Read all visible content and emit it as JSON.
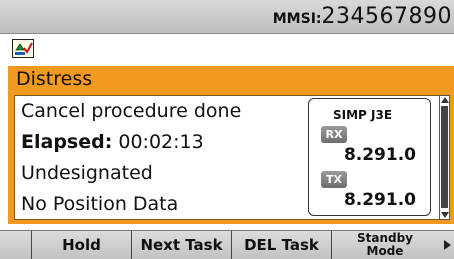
{
  "header": {
    "mmsi_label": "MMSI:",
    "mmsi_value": "234567890"
  },
  "status": {
    "icon": "position-update-icon"
  },
  "panel": {
    "title": "Distress",
    "lines": {
      "line1": "Cancel procedure done",
      "elapsed_label": "Elapsed:",
      "elapsed_value": "00:02:13",
      "line3": "Undesignated",
      "line4": "No Position Data"
    },
    "radio": {
      "channel": "SIMP J3E",
      "rx_label": "RX",
      "rx_freq": "8.291.0",
      "tx_label": "TX",
      "tx_freq": "8.291.0"
    }
  },
  "softkeys": {
    "hold": "Hold",
    "next_task": "Next Task",
    "del_task": "DEL Task",
    "standby_1": "Standby",
    "standby_2": "Mode"
  },
  "colors": {
    "accent": "#f29a1f",
    "bar": "#c8c8c8"
  }
}
